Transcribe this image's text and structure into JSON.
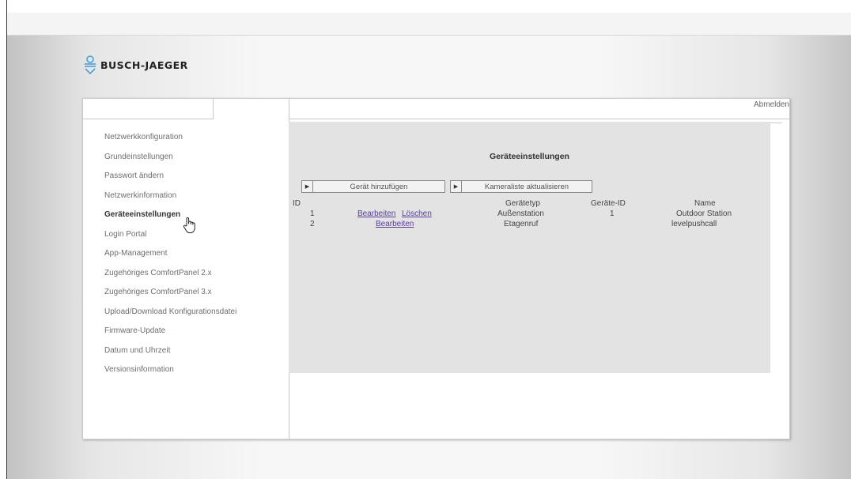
{
  "brand": {
    "name": "BUSCH-JAEGER",
    "color": "#4a9fd8"
  },
  "header": {
    "logout_label": "Abmelden"
  },
  "sidebar": {
    "items": [
      {
        "label": "Netzwerkkonfiguration"
      },
      {
        "label": "Grundeinstellungen"
      },
      {
        "label": "Passwort ändern"
      },
      {
        "label": "Netzwerkinformation"
      },
      {
        "label": "Geräteeinstellungen",
        "active": true
      },
      {
        "label": "Login Portal"
      },
      {
        "label": "App-Management"
      },
      {
        "label": "Zugehöriges ComfortPanel 2.x"
      },
      {
        "label": "Zugehöriges ComfortPanel 3.x"
      },
      {
        "label": "Upload/Download Konfigurationsdatei"
      },
      {
        "label": "Firmware-Update"
      },
      {
        "label": "Datum und Uhrzeit"
      },
      {
        "label": "Versionsinformation"
      }
    ]
  },
  "main": {
    "title": "Geräteeinstellungen",
    "add_device_label": "Gerät hinzufügen",
    "refresh_camera_label": "Kameraliste aktualisieren",
    "table": {
      "headers": {
        "id": "ID",
        "type": "Gerätetyp",
        "device_id": "Geräte-ID",
        "name": "Name"
      },
      "rows": [
        {
          "id": "1",
          "edit": "Bearbeiten",
          "delete": "Löschen",
          "type": "Außenstation",
          "device_id": "1",
          "name": "Outdoor Station"
        },
        {
          "id": "2",
          "edit": "Bearbeiten",
          "type": "Etagenruf",
          "device_id": "",
          "name": "levelpushcall"
        }
      ]
    }
  },
  "icons": {
    "arrow": "play-arrow-icon",
    "cursor": "hand-pointer-icon"
  }
}
